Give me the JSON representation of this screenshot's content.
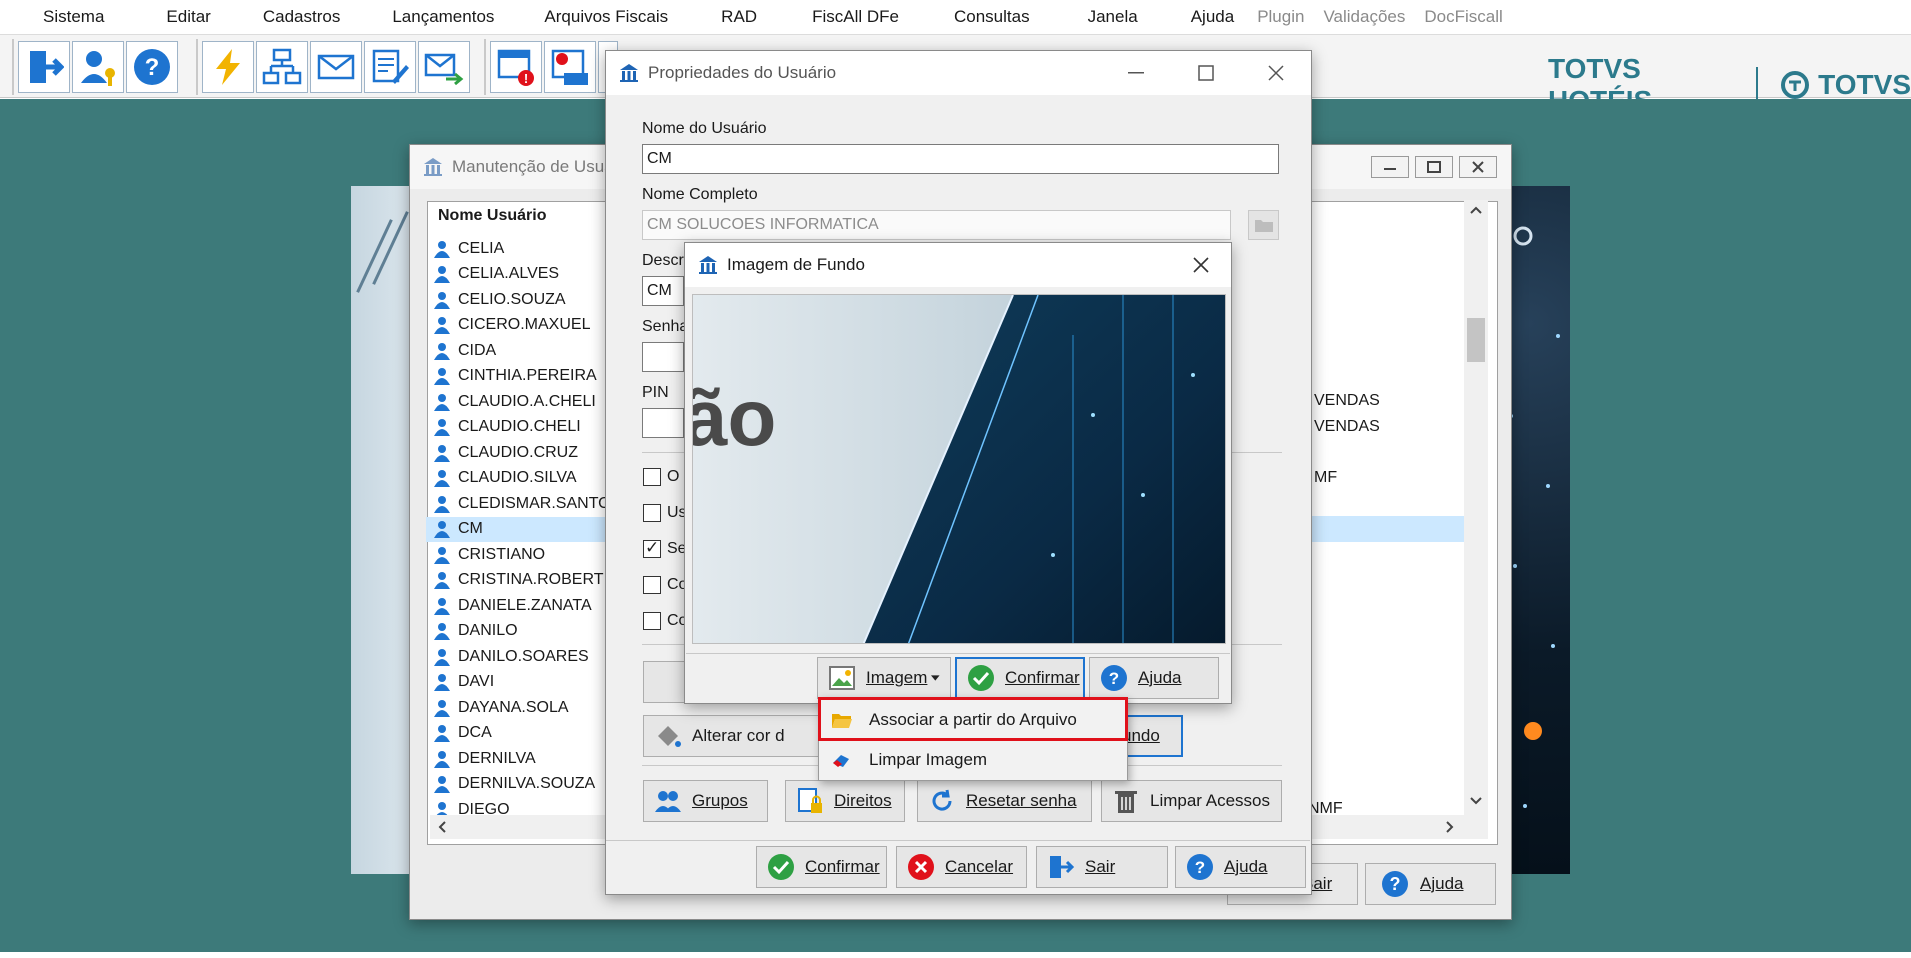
{
  "menubar": {
    "items": [
      "Sistema",
      "Editar",
      "Cadastros",
      "Lançamentos",
      "Arquivos Fiscais",
      "RAD",
      "FiscAll DFe",
      "Consultas",
      "Janela",
      "Ajuda"
    ],
    "disabled_items": [
      "Plugin",
      "Validações",
      "DocFiscall"
    ]
  },
  "toolbar": {
    "icons": [
      "exit-icon",
      "user-key-icon",
      "help-icon",
      "lightning-icon",
      "network-icon",
      "mail-icon",
      "document-edit-icon",
      "mail-send-icon",
      "window-error-icon",
      "icms-icon"
    ]
  },
  "brand": {
    "left": "TOTVS HOTÉIS",
    "right": "TOTVS"
  },
  "colors": {
    "desktop": "#3d7a7a",
    "accent": "#1e74d0",
    "highlight": "#e0111b",
    "selection": "#cce8ff"
  },
  "man_window": {
    "title": "Manutenção de Usuários",
    "column_header": "Nome Usuário",
    "users": [
      "CELIA",
      "CELIA.ALVES",
      "CELIO.SOUZA",
      "CICERO.MAXUEL",
      "CIDA",
      "CINTHIA.PEREIRA",
      "CLAUDIO.A.CHELI",
      "CLAUDIO.CHELI",
      "CLAUDIO.CRUZ",
      "CLAUDIO.SILVA",
      "CLEDISMAR.SANTOS",
      "CM",
      "CRISTIANO",
      "CRISTINA.ROBERT",
      "DANIELE.ZANATA",
      "DANILO",
      "DANILO.SOARES",
      "DAVI",
      "DAYANA.SOLA",
      "DCA",
      "DERNILVA",
      "DERNILVA.SOUZA",
      "DIEGO"
    ],
    "selected_user": "CM",
    "right_col": [
      "VENDAS",
      "VENDAS",
      "MF",
      "NMF"
    ],
    "buttons": {
      "sair": "Sair",
      "ajuda": "Ajuda"
    }
  },
  "prop_window": {
    "title": "Propriedades do Usuário",
    "nome_usuario_label": "Nome do Usuário",
    "nome_usuario_value": "CM",
    "nome_completo_label": "Nome Completo",
    "nome_completo_value": "CM SOLUCOES INFORMATICA",
    "descricao_label": "Descr",
    "descricao_value": "CM",
    "senha_label": "Senha",
    "pin_label": "PIN",
    "checkboxes": [
      {
        "label": "O",
        "checked": false
      },
      {
        "label": "Us",
        "checked": false
      },
      {
        "label": "Se",
        "checked": true
      },
      {
        "label": "Co",
        "checked": false
      },
      {
        "label": "Co",
        "checked": false
      }
    ],
    "btn_alterar_cor": "Alterar cor d",
    "btn_imagem_fundo": "undo",
    "btn_grupos": "Grupos",
    "btn_direitos": "Direitos",
    "btn_resetar": "Resetar senha",
    "btn_limpar_acessos": "Limpar Acessos",
    "btn_confirmar": "Confirmar",
    "btn_cancelar": "Cancelar",
    "btn_sair": "Sair",
    "btn_ajuda": "Ajuda"
  },
  "img_dialog": {
    "title": "Imagem de Fundo",
    "preview_text": "ão",
    "btn_imagem": "Imagem",
    "btn_confirmar": "Confirmar",
    "btn_ajuda": "Ajuda"
  },
  "context_menu": {
    "items": [
      "Associar a partir do Arquivo",
      "Limpar Imagem"
    ]
  }
}
